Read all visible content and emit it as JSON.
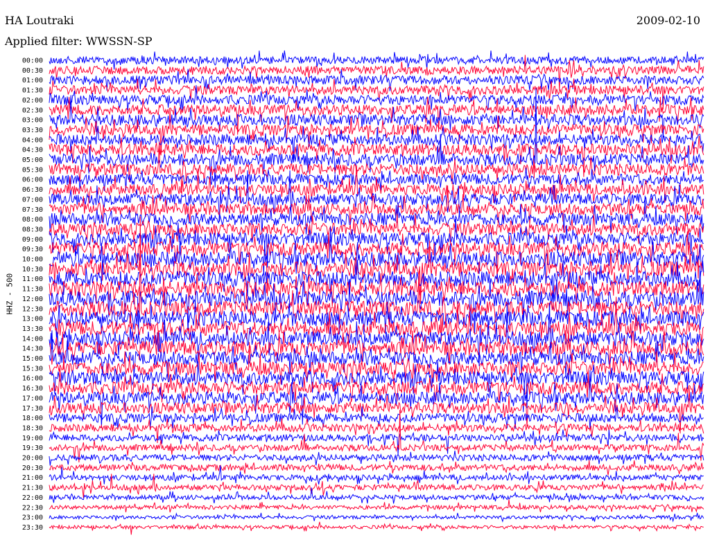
{
  "header": {
    "station": "HA Loutraki",
    "date": "2009-02-10",
    "filter": "Applied filter: WWSSN-SP",
    "channel": "HHZ - 500"
  },
  "chart_data": {
    "type": "line",
    "title": "HA Loutraki",
    "ylabel": "HHZ - 500",
    "xlabel": "",
    "row_labels": [
      "00:00",
      "00:30",
      "01:00",
      "01:30",
      "02:00",
      "02:30",
      "03:00",
      "03:30",
      "04:00",
      "04:30",
      "05:00",
      "05:30",
      "06:00",
      "06:30",
      "07:00",
      "07:30",
      "08:00",
      "08:30",
      "09:00",
      "09:30",
      "10:00",
      "10:30",
      "11:00",
      "11:30",
      "12:00",
      "12:30",
      "13:00",
      "13:30",
      "14:00",
      "14:30",
      "15:00",
      "15:30",
      "16:00",
      "16:30",
      "17:00",
      "17:30",
      "18:00",
      "18:30",
      "19:00",
      "19:30",
      "20:00",
      "20:30",
      "21:00",
      "21:30",
      "22:00",
      "22:30",
      "23:00",
      "23:30"
    ],
    "series_colors": [
      "#0000ff",
      "#ff0033"
    ],
    "row_amplitude": [
      1.1,
      1.2,
      1.3,
      1.3,
      1.4,
      1.5,
      1.6,
      1.6,
      1.6,
      1.7,
      1.7,
      1.7,
      1.6,
      1.6,
      1.7,
      1.7,
      1.8,
      1.8,
      1.9,
      2.0,
      2.1,
      2.2,
      2.2,
      2.2,
      2.2,
      2.2,
      2.2,
      2.1,
      2.1,
      2.1,
      2.0,
      2.0,
      2.0,
      1.9,
      1.8,
      1.6,
      1.3,
      1.1,
      1.0,
      0.9,
      0.9,
      0.9,
      0.8,
      0.8,
      0.7,
      0.6,
      0.5,
      0.5
    ],
    "grid": false
  }
}
